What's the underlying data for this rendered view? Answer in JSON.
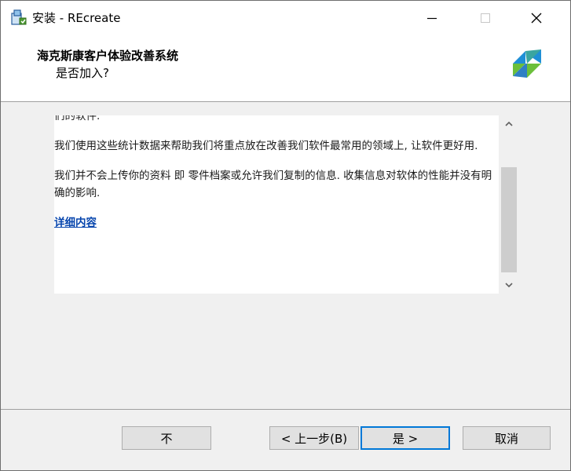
{
  "window": {
    "title": "安装 - REcreate",
    "controls": {
      "minimize": "—",
      "close": "✕"
    }
  },
  "header": {
    "title": "海克斯康客户体验改善系统",
    "subtitle": "是否加入?"
  },
  "content": {
    "truncated_line": "们的软件.",
    "paragraphs": [
      "我们使用这些统计数据来帮助我们将重点放在改善我们软件最常用的领域上, 让软件更好用.",
      "我们并不会上传你的资料 即 零件档案或允许我们复制的信息. 收集信息对软体的性能并没有明确的影响."
    ],
    "link": "详细内容"
  },
  "buttons": {
    "no": "不",
    "back": "< 上一步(B)",
    "yes": "是 >",
    "cancel": "取消"
  },
  "colors": {
    "accent": "#0078d7",
    "link": "#0645ad",
    "logo_blue": "#1f8fd6",
    "logo_green": "#6bbf3b"
  },
  "icons": {
    "app": "installer-icon",
    "logo": "hexagon-logo",
    "scroll_up": "chevron-up-icon",
    "scroll_down": "chevron-down-icon"
  }
}
